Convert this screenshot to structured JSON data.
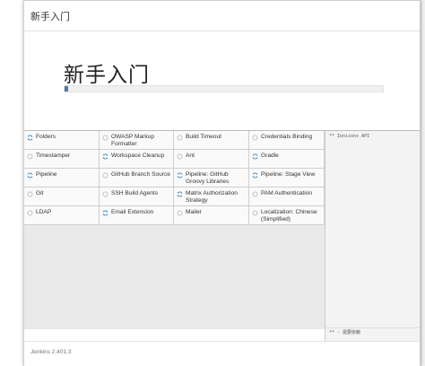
{
  "header": {
    "title": "新手入门"
  },
  "hero": {
    "title": "新手入门",
    "progress": 0.01
  },
  "plugins": {
    "rows": [
      [
        {
          "label": "Folders",
          "status": "installing"
        },
        {
          "label": "OWASP Markup Formatter",
          "status": "pending"
        },
        {
          "label": "Build Timeout",
          "status": "pending"
        },
        {
          "label": "Credentials Binding",
          "status": "pending"
        }
      ],
      [
        {
          "label": "Timestamper",
          "status": "pending"
        },
        {
          "label": "Workspace Cleanup",
          "status": "installing"
        },
        {
          "label": "Ant",
          "status": "pending"
        },
        {
          "label": "Gradle",
          "status": "installing"
        }
      ],
      [
        {
          "label": "Pipeline",
          "status": "installing"
        },
        {
          "label": "GitHub Branch Source",
          "status": "pending"
        },
        {
          "label": "Pipeline: GitHub Groovy Libraries",
          "status": "installing"
        },
        {
          "label": "Pipeline: Stage View",
          "status": "installing"
        }
      ],
      [
        {
          "label": "Git",
          "status": "pending"
        },
        {
          "label": "SSH Build Agents",
          "status": "pending"
        },
        {
          "label": "Matrix Authorization Strategy",
          "status": "installing"
        },
        {
          "label": "PAM Authentication",
          "status": "pending"
        }
      ],
      [
        {
          "label": "LDAP",
          "status": "pending"
        },
        {
          "label": "Email Extension",
          "status": "installing"
        },
        {
          "label": "Mailer",
          "status": "pending"
        },
        {
          "label": "Localization: Chinese (Simplified)",
          "status": "pending"
        }
      ]
    ]
  },
  "sidebar": {
    "log_top": "** Ionicons API",
    "log_bottom": "** - 需要依赖"
  },
  "footer": {
    "version": "Jenkins 2.401.3"
  },
  "colors": {
    "accent": "#4e7ca6",
    "installing_icon": "#4a8fc4",
    "pending_icon": "#bbbbbb"
  }
}
